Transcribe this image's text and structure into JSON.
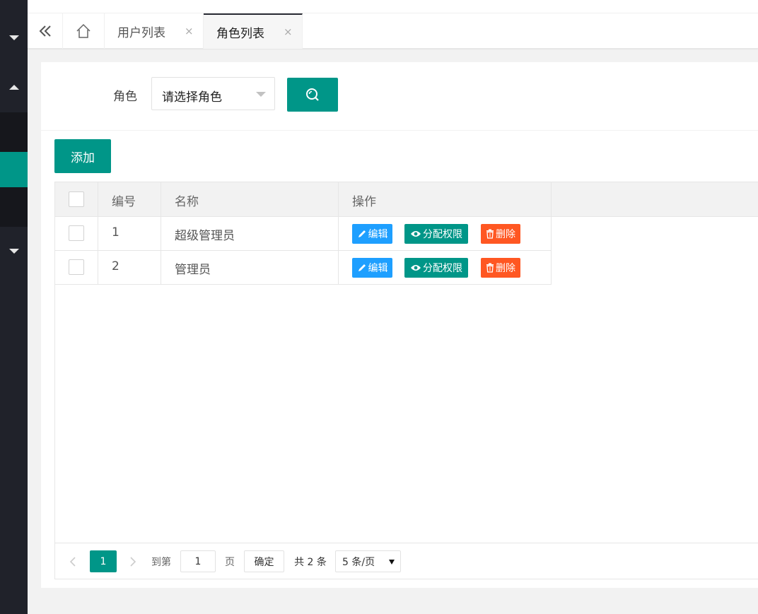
{
  "tabs": [
    {
      "label": "用户列表",
      "close": "×",
      "active": false
    },
    {
      "label": "角色列表",
      "close": "×",
      "active": true
    }
  ],
  "search": {
    "label": "角色",
    "select_value": "请选择角色"
  },
  "toolbar": {
    "add_label": "添加"
  },
  "table": {
    "columns": [
      "编号",
      "名称",
      "操作"
    ],
    "rows": [
      {
        "id": "1",
        "name": "超级管理员"
      },
      {
        "id": "2",
        "name": "管理员"
      }
    ],
    "actions": {
      "edit": "编辑",
      "assign": "分配权限",
      "delete": "删除"
    }
  },
  "pagination": {
    "current_page": "1",
    "goto_prefix": "到第",
    "goto_value": "1",
    "goto_suffix": "页",
    "confirm": "确定",
    "total": "共 2 条",
    "page_size": "5 条/页"
  },
  "colors": {
    "primary": "#009688",
    "edit": "#1e9fff",
    "delete": "#ff5722",
    "sidebar": "#20222a"
  }
}
